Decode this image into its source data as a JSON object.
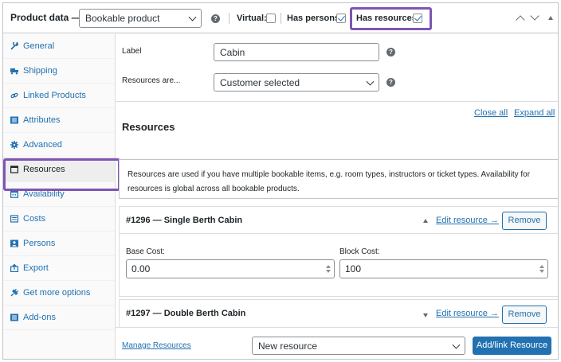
{
  "header": {
    "title": "Product data —",
    "product_type": "Bookable product",
    "virtual_label": "Virtual:",
    "virtual_checked": false,
    "has_persons_label": "Has persons:",
    "has_persons_checked": true,
    "has_resources_label": "Has resources:",
    "has_resources_checked": true,
    "highlight_color": "#7f54b3"
  },
  "sidebar": {
    "items": [
      {
        "label": "General",
        "icon": "wrench-icon"
      },
      {
        "label": "Shipping",
        "icon": "truck-icon"
      },
      {
        "label": "Linked Products",
        "icon": "link-icon"
      },
      {
        "label": "Attributes",
        "icon": "list-icon"
      },
      {
        "label": "Advanced",
        "icon": "gear-icon"
      },
      {
        "label": "Resources",
        "icon": "resource-icon"
      },
      {
        "label": "Availability",
        "icon": "calendar-icon"
      },
      {
        "label": "Costs",
        "icon": "costs-icon"
      },
      {
        "label": "Persons",
        "icon": "person-icon"
      },
      {
        "label": "Export",
        "icon": "export-icon"
      },
      {
        "label": "Get more options",
        "icon": "plugin-icon"
      },
      {
        "label": "Add-ons",
        "icon": "addons-icon"
      }
    ],
    "active": "Resources"
  },
  "main": {
    "label_field": {
      "label": "Label",
      "value": "Cabin"
    },
    "resources_are": {
      "label": "Resources are...",
      "value": "Customer selected"
    },
    "close_all": "Close all",
    "expand_all": "Expand all",
    "heading": "Resources",
    "notice_line1": "Resources are used if you have multiple bookable items, e.g. room types, instructors or ticket types. Availability for",
    "notice_line2": "resources is global across all bookable products.",
    "resources": [
      {
        "title": "#1296 — Single Berth Cabin",
        "edit_link": "Edit resource →",
        "remove": "Remove",
        "base_cost_label": "Base Cost:",
        "base_cost": "0.00",
        "block_cost_label": "Block Cost:",
        "block_cost": "100"
      },
      {
        "title": "#1297 — Double Berth Cabin",
        "edit_link": "Edit resource →",
        "remove": "Remove"
      }
    ],
    "manage_resources": "Manage Resources",
    "new_resource": "New resource",
    "add_link_resource": "Add/link Resource"
  }
}
